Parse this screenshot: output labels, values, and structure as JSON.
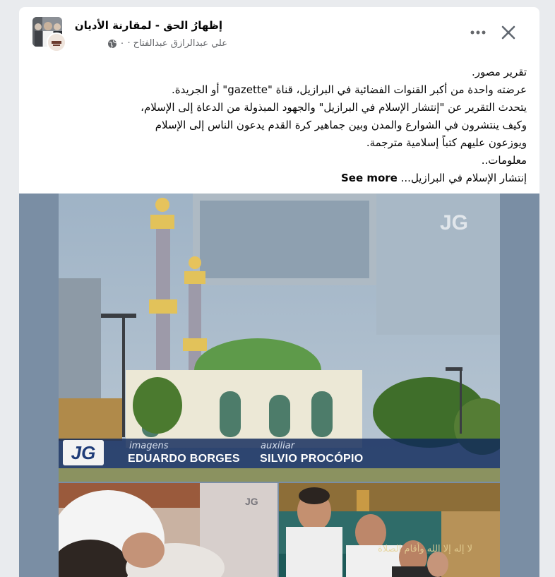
{
  "post": {
    "page_name": "إظهارُ الحق - لمقارنة الأديان",
    "author_line": "علي عبدالرازق عبدالفتاح",
    "time": "٠",
    "separator": "·",
    "text_lines": [
      "تقرير مصور.",
      "عرضته واحدة من أكبر القنوات الفضائية في البرازيل، قناة \"gazette\" أو الجريدة.",
      "يتحدث التقرير عن  \"إنتشار الإسلام في البرازيل\"  والجهود المبذولة من الدعاة إلى الإسلام،",
      "وكيف ينتشرون في الشوارع والمدن وبين جماهير كرة القدم  يدعون الناس إلى الإسلام",
      "ويوزعون عليهم كتباً إسلامية مترجمة.",
      "معلومات..",
      "إنتشار الإسلام في البرازيل..."
    ],
    "see_more": "See more"
  },
  "media": {
    "logo_text": "JG",
    "caption": {
      "label_1": "imagens",
      "name_1": "EDUARDO BORGES",
      "label_2": "auxiliar",
      "name_2": "SILVIO PROCÓPIO"
    },
    "arabic_calligraphy": "لا إله إلا الله وأقام الصلاة"
  },
  "icons": {
    "close": "close-icon",
    "more": "more-options-icon",
    "globe": "globe-icon"
  },
  "colors": {
    "name_text": "#050505",
    "meta_text": "#65676b",
    "caption_bg": "#0f285a"
  }
}
